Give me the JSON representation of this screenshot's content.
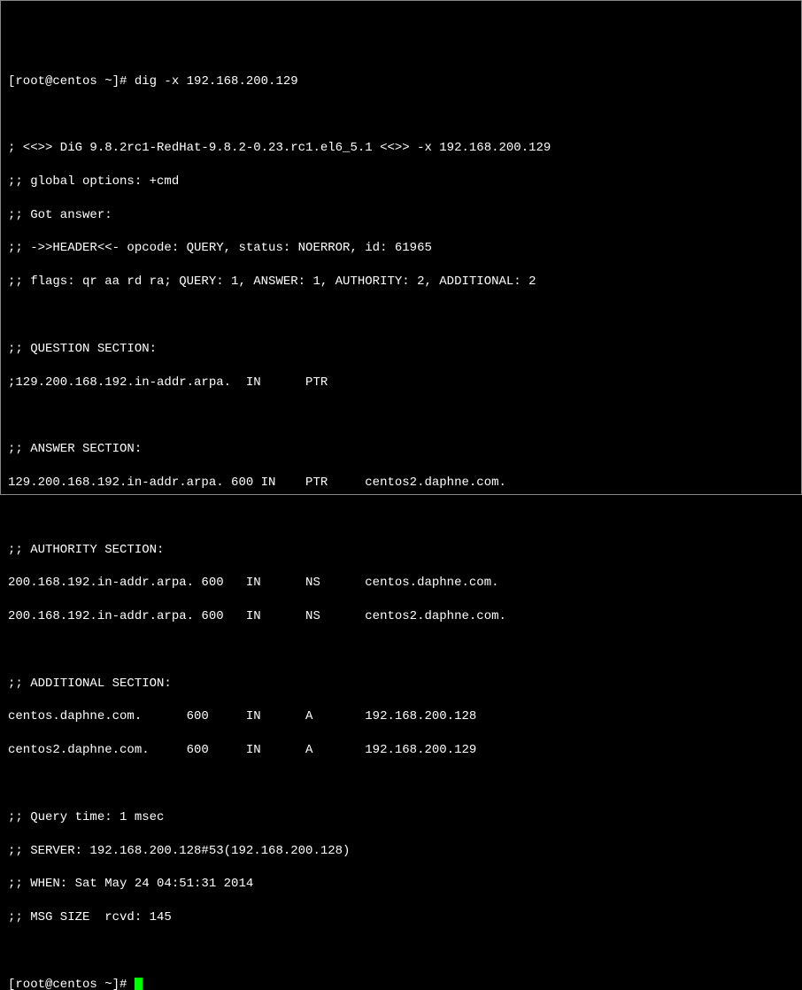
{
  "prompt1": {
    "user_host": "[root@centos ~]#",
    "command": "dig -x 192.168.200.129"
  },
  "blank1": "",
  "banner": "; <<>> DiG 9.8.2rc1-RedHat-9.8.2-0.23.rc1.el6_5.1 <<>> -x 192.168.200.129",
  "global_options": ";; global options: +cmd",
  "got_answer": ";; Got answer:",
  "header_line": ";; ->>HEADER<<- opcode: QUERY, status: NOERROR, id: 61965",
  "flags_line": ";; flags: qr aa rd ra; QUERY: 1, ANSWER: 1, AUTHORITY: 2, ADDITIONAL: 2",
  "blank2": "",
  "question_header": ";; QUESTION SECTION:",
  "question_row": ";129.200.168.192.in-addr.arpa.  IN      PTR",
  "blank3": "",
  "answer_header": ";; ANSWER SECTION:",
  "answer_row": "129.200.168.192.in-addr.arpa. 600 IN    PTR     centos2.daphne.com.",
  "blank4": "",
  "authority_header": ";; AUTHORITY SECTION:",
  "authority_row1": "200.168.192.in-addr.arpa. 600   IN      NS      centos.daphne.com.",
  "authority_row2": "200.168.192.in-addr.arpa. 600   IN      NS      centos2.daphne.com.",
  "blank5": "",
  "additional_header": ";; ADDITIONAL SECTION:",
  "additional_row1": "centos.daphne.com.      600     IN      A       192.168.200.128",
  "additional_row2": "centos2.daphne.com.     600     IN      A       192.168.200.129",
  "blank6": "",
  "query_time": ";; Query time: 1 msec",
  "server_line": ";; SERVER: 192.168.200.128#53(192.168.200.128)",
  "when_line": ";; WHEN: Sat May 24 04:51:31 2014",
  "msg_size": ";; MSG SIZE  rcvd: 145",
  "blank7": "",
  "prompt2": {
    "user_host": "[root@centos ~]#"
  }
}
